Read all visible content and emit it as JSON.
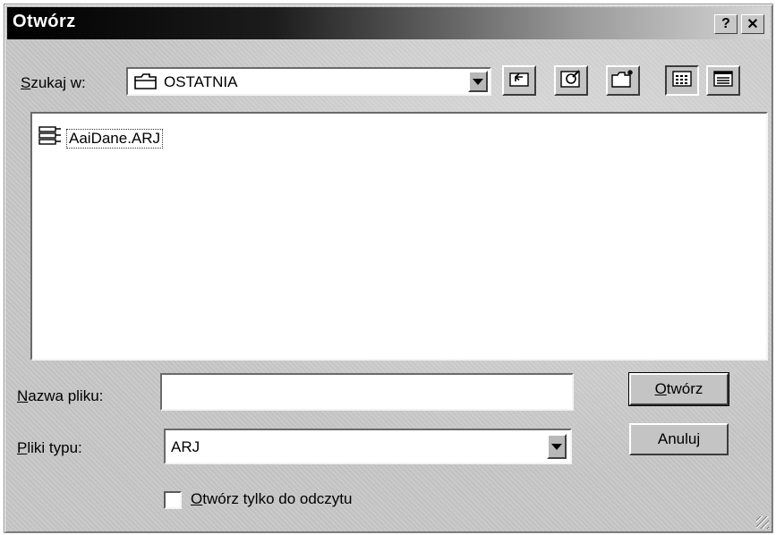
{
  "window": {
    "title": "Otwórz",
    "help_label": "?",
    "close_label": "✕"
  },
  "lookin": {
    "label": "Szukaj w:",
    "value": "OSTATNIA",
    "icon": "folder-icon"
  },
  "toolbar": {
    "buttons": [
      {
        "name": "up-one-level-button",
        "icon": "up-folder-icon"
      },
      {
        "name": "favorites-button",
        "icon": "favorites-icon"
      },
      {
        "name": "new-folder-button",
        "icon": "new-folder-icon"
      },
      {
        "name": "list-view-button",
        "icon": "list-view-icon"
      },
      {
        "name": "details-view-button",
        "icon": "details-view-icon"
      }
    ]
  },
  "files": [
    {
      "name": "AaiDane.ARJ",
      "icon": "archive-icon"
    }
  ],
  "filename": {
    "label": "Nazwa pliku:",
    "value": ""
  },
  "filetype": {
    "label": "Pliki typu:",
    "value": "ARJ"
  },
  "buttons": {
    "open": "Otwórz",
    "cancel": "Anuluj"
  },
  "readonly": {
    "label": "Otwórz tylko do odczytu",
    "checked": false
  }
}
